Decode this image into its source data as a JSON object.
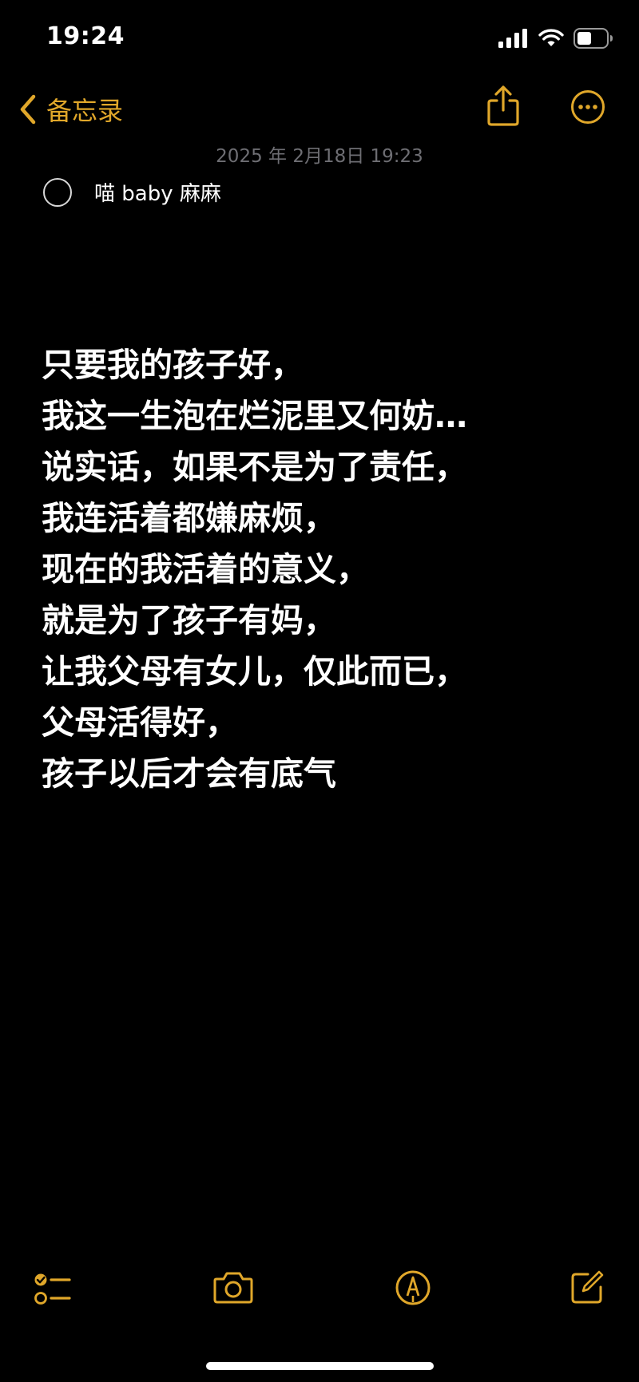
{
  "status_bar": {
    "time": "19:24",
    "icons": [
      "cellular-signal-icon",
      "wifi-icon",
      "battery-icon"
    ]
  },
  "nav": {
    "back_label": "备忘录",
    "back_icon": "chevron-left-icon",
    "share_icon": "share-icon",
    "more_icon": "more-icon"
  },
  "note": {
    "timestamp": "2025 年 2月18日 19:23",
    "checklist": [
      {
        "text": "喵 baby 麻麻",
        "checked": false
      }
    ],
    "lines": [
      "只要我的孩子好，",
      "我这一生泡在烂泥里又何妨…",
      "说实话，如果不是为了责任，",
      "我连活着都嫌麻烦，",
      "现在的我活着的意义，",
      "就是为了孩子有妈，",
      "让我父母有女儿，仅此而已，",
      "父母活得好，",
      "孩子以后才会有底气"
    ]
  },
  "toolbar": {
    "icons": [
      "checklist-icon",
      "camera-icon",
      "markup-icon",
      "compose-icon"
    ]
  },
  "colors": {
    "accent": "#e0a72a",
    "background": "#000000",
    "text": "#ffffff",
    "secondary_text": "#6e6e73"
  }
}
